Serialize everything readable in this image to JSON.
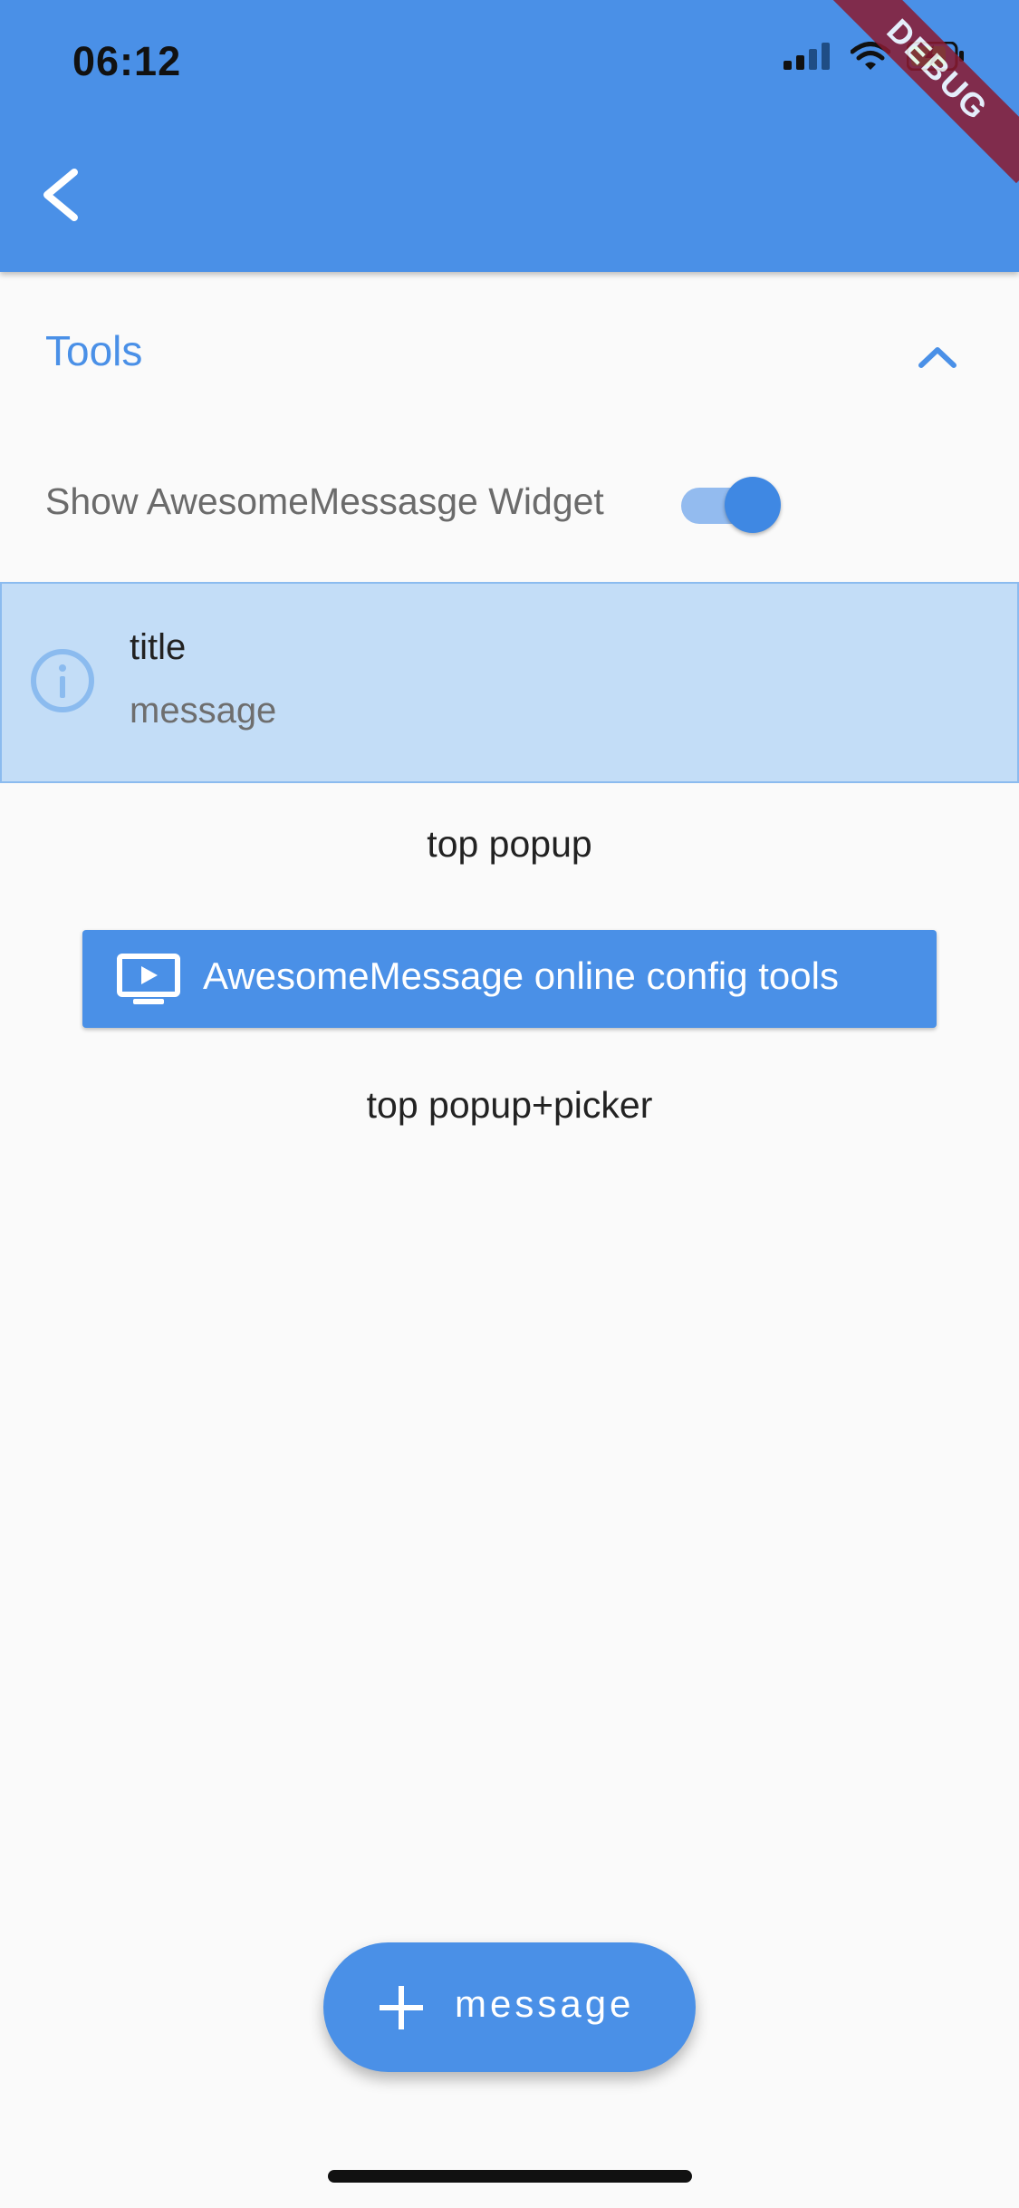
{
  "status_bar": {
    "time": "06:12",
    "icons": [
      "signal-icon",
      "wifi-icon",
      "battery-charging-icon"
    ]
  },
  "debug_banner": {
    "label": "DEBUG"
  },
  "app_bar": {
    "back_icon": "chevron-left-icon"
  },
  "tools_section": {
    "title": "Tools",
    "expanded": true,
    "chevron_icon": "chevron-up-icon"
  },
  "toggle": {
    "label": "Show AwesomeMessasge Widget",
    "on": true
  },
  "message_preview": {
    "icon": "info-outline-icon",
    "title": "title",
    "message": "message"
  },
  "buttons": {
    "top_popup": "top popup",
    "config_tools": "AwesomeMessage online config tools",
    "config_icon": "monitor-play-icon",
    "top_popup_picker": "top popup+picker"
  },
  "fab": {
    "icon": "plus-icon",
    "label": "message"
  },
  "colors": {
    "primary": "#4a90e7",
    "card_background": "#c3ddf7",
    "background": "#fafafa"
  }
}
